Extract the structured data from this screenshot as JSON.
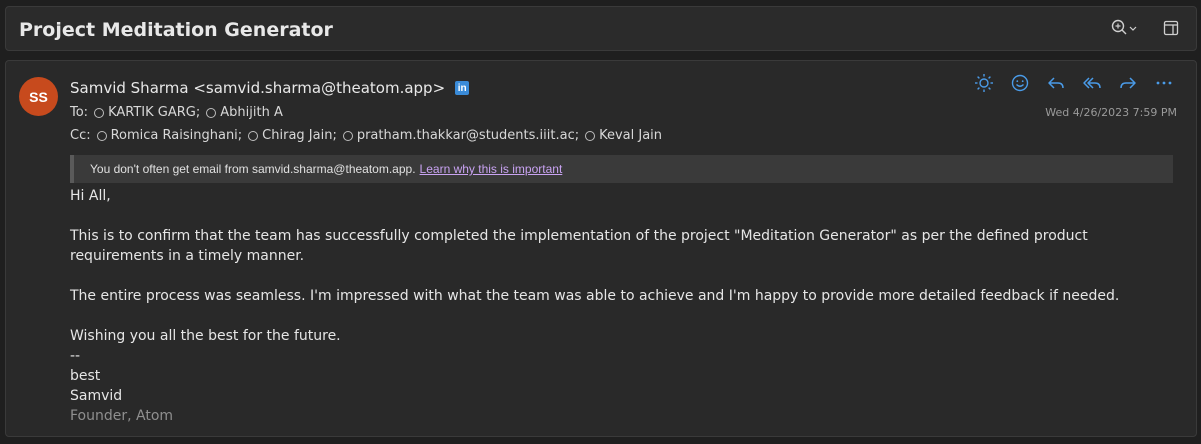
{
  "subject": "Project Meditation Generator",
  "sender": {
    "initials": "SS",
    "display": "Samvid Sharma <samvid.sharma@theatom.app>",
    "avatar_color": "#c74a1d"
  },
  "to": {
    "label": "To:",
    "recipients": [
      "KARTIK GARG;",
      "Abhijith A"
    ]
  },
  "cc": {
    "label": "Cc:",
    "recipients": [
      "Romica Raisinghani;",
      "Chirag Jain;",
      "pratham.thakkar@students.iiit.ac;",
      "Keval Jain"
    ]
  },
  "date": "Wed 4/26/2023 7:59 PM",
  "notice": {
    "text": "You don't often get email from samvid.sharma@theatom.app.",
    "link": "Learn why this is important"
  },
  "body": {
    "greeting": "Hi All,",
    "para1": "This is to confirm that the team has successfully completed the implementation of the project \"Meditation Generator\" as per the defined product requirements in a timely manner.",
    "para2": "The entire process was seamless. I'm impressed with what the team was able to achieve and I'm happy to provide more detailed feedback if needed.",
    "para3": "Wishing you all the best for the future.",
    "sig_sep": "--",
    "sig_best": "best",
    "sig_name": "Samvid",
    "sig_title": "Founder, Atom"
  },
  "icons": {
    "zoom": "zoom-icon",
    "popout": "popout-icon",
    "linkedin": "linkedin-icon",
    "summarize": "sun-icon",
    "emoji": "emoji-icon",
    "reply": "reply-icon",
    "reply_all": "reply-all-icon",
    "forward": "forward-icon",
    "more": "more-icon"
  },
  "colors": {
    "accent": "#3a8bd8",
    "link": "#c9a3f2"
  }
}
